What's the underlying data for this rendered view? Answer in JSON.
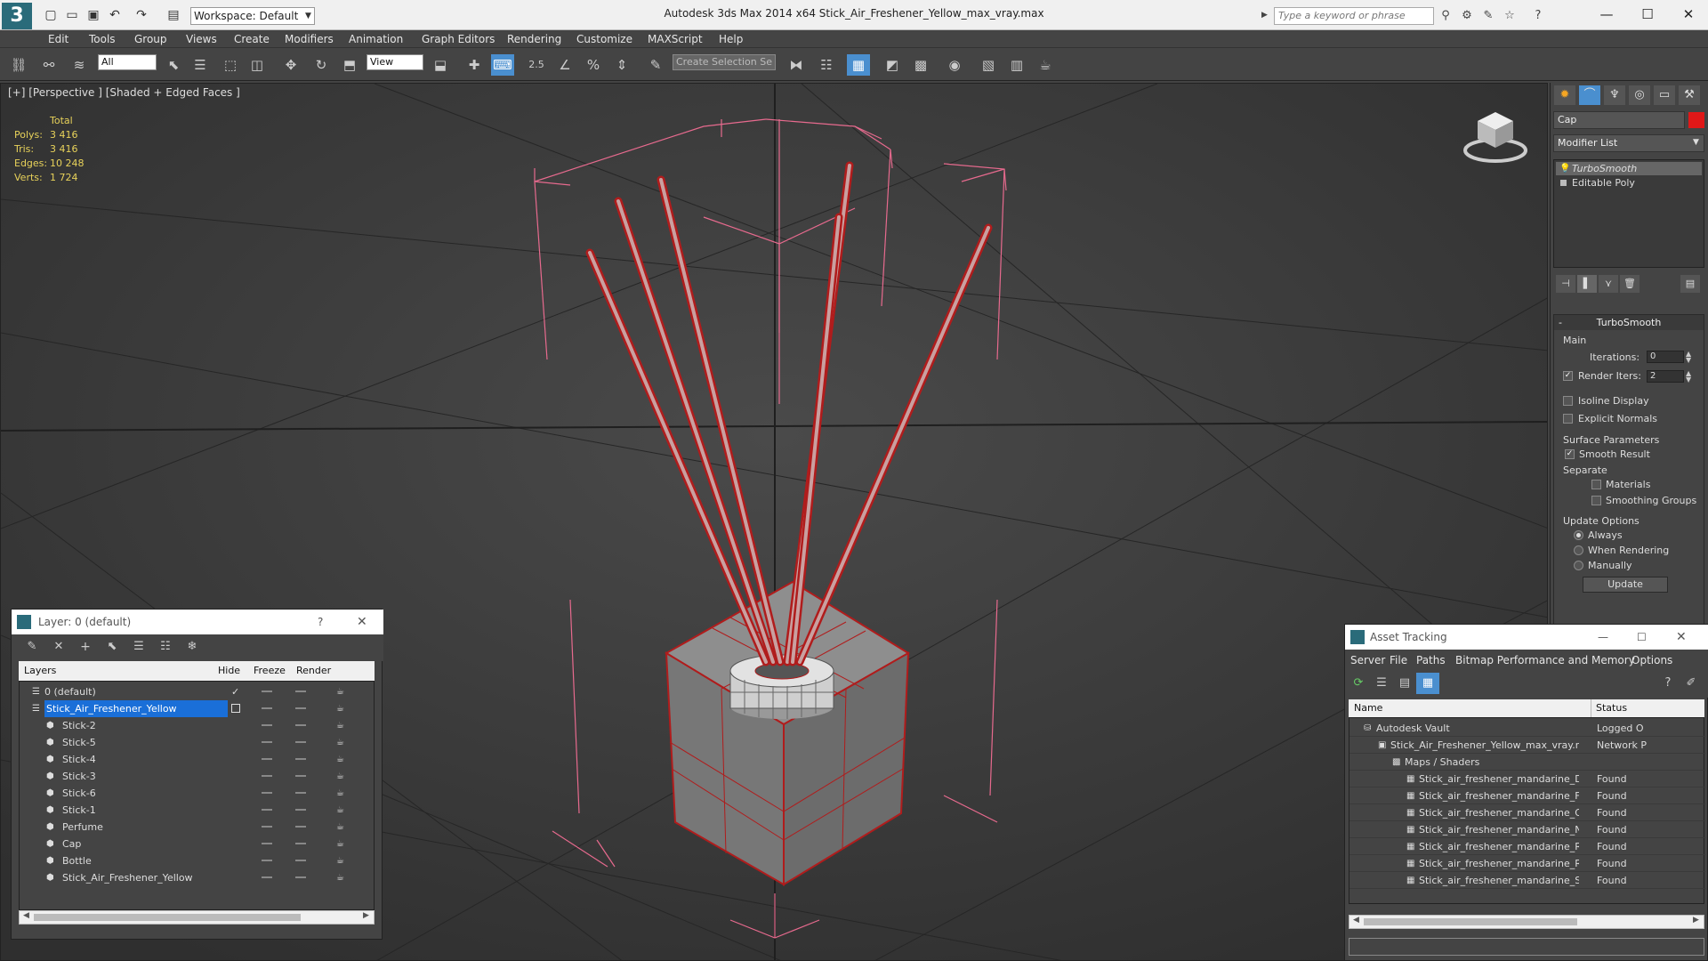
{
  "titlebar": {
    "logo_glyph": "3",
    "workspace": "Workspace: Default",
    "app_title": "Autodesk 3ds Max  2014 x64       Stick_Air_Freshener_Yellow_max_vray.max",
    "search_placeholder": "Type a keyword or phrase"
  },
  "menu": [
    "Edit",
    "Tools",
    "Group",
    "Views",
    "Create",
    "Modifiers",
    "Animation",
    "Graph Editors",
    "Rendering",
    "Customize",
    "MAXScript",
    "Help"
  ],
  "toolbar": {
    "filter": "All",
    "refcoord": "View",
    "snap_value": "2.5",
    "selection_set": "Create Selection Se"
  },
  "viewport": {
    "label": "[+] [Perspective ] [Shaded + Edged Faces ]",
    "stats_header": "Total",
    "stats": [
      {
        "label": "Polys:",
        "value": "3 416"
      },
      {
        "label": "Tris:",
        "value": "3 416"
      },
      {
        "label": "Edges:",
        "value": "10 248"
      },
      {
        "label": "Verts:",
        "value": "1 724"
      }
    ]
  },
  "command_panel": {
    "object_name": "Cap",
    "modifier_list": "Modifier List",
    "stack": [
      "TurboSmooth",
      "Editable Poly"
    ],
    "turbosmooth": {
      "title": "TurboSmooth",
      "main": "Main",
      "iterations_label": "Iterations:",
      "iterations": "0",
      "render_iters_label": "Render Iters:",
      "render_iters": "2",
      "isoline": "Isoline Display",
      "explicit": "Explicit Normals",
      "surface": "Surface Parameters",
      "smooth": "Smooth Result",
      "separate": "Separate",
      "materials": "Materials",
      "smoothing_groups": "Smoothing Groups",
      "update_options": "Update Options",
      "always": "Always",
      "when_rendering": "When Rendering",
      "manually": "Manually",
      "update": "Update"
    }
  },
  "layer_window": {
    "title": "Layer: 0 (default)",
    "help": "?",
    "close": "✕",
    "columns": [
      "Layers",
      "Hide",
      "Freeze",
      "Render"
    ],
    "rows": [
      {
        "name": "0 (default)",
        "indent": 1,
        "selected": false,
        "current": true
      },
      {
        "name": "Stick_Air_Freshener_Yellow",
        "indent": 1,
        "selected": true,
        "current": false
      },
      {
        "name": "Stick-2",
        "indent": 2,
        "selected": false,
        "current": false
      },
      {
        "name": "Stick-5",
        "indent": 2,
        "selected": false,
        "current": false
      },
      {
        "name": "Stick-4",
        "indent": 2,
        "selected": false,
        "current": false
      },
      {
        "name": "Stick-3",
        "indent": 2,
        "selected": false,
        "current": false
      },
      {
        "name": "Stick-6",
        "indent": 2,
        "selected": false,
        "current": false
      },
      {
        "name": "Stick-1",
        "indent": 2,
        "selected": false,
        "current": false
      },
      {
        "name": "Perfume",
        "indent": 2,
        "selected": false,
        "current": false
      },
      {
        "name": "Cap",
        "indent": 2,
        "selected": false,
        "current": false
      },
      {
        "name": "Bottle",
        "indent": 2,
        "selected": false,
        "current": false
      },
      {
        "name": "Stick_Air_Freshener_Yellow",
        "indent": 2,
        "selected": false,
        "current": false
      }
    ]
  },
  "asset_window": {
    "title": "Asset Tracking",
    "menu": [
      "Server",
      "File",
      "Paths",
      "Bitmap Performance and Memory",
      "Options"
    ],
    "columns": [
      "Name",
      "Status"
    ],
    "rows": [
      {
        "name": "Autodesk Vault",
        "indent": 1,
        "status": "Logged O"
      },
      {
        "name": "Stick_Air_Freshener_Yellow_max_vray.max",
        "indent": 2,
        "status": "Network P"
      },
      {
        "name": "Maps / Shaders",
        "indent": 3,
        "status": ""
      },
      {
        "name": "Stick_air_freshener_mandarine_Diffuse.png",
        "indent": 4,
        "status": "Found"
      },
      {
        "name": "Stick_air_freshener_mandarine_Fresnel.png",
        "indent": 4,
        "status": "Found"
      },
      {
        "name": "Stick_air_freshener_mandarine_Glossiness.png",
        "indent": 4,
        "status": "Found"
      },
      {
        "name": "Stick_air_freshener_mandarine_Normal.png",
        "indent": 4,
        "status": "Found"
      },
      {
        "name": "Stick_air_freshener_mandarine_Refraction.png",
        "indent": 4,
        "status": "Found"
      },
      {
        "name": "Stick_air_freshener_mandarine_RefrGloss.png",
        "indent": 4,
        "status": "Found"
      },
      {
        "name": "Stick_air_freshener_mandarine_Specular.png",
        "indent": 4,
        "status": "Found"
      }
    ]
  }
}
